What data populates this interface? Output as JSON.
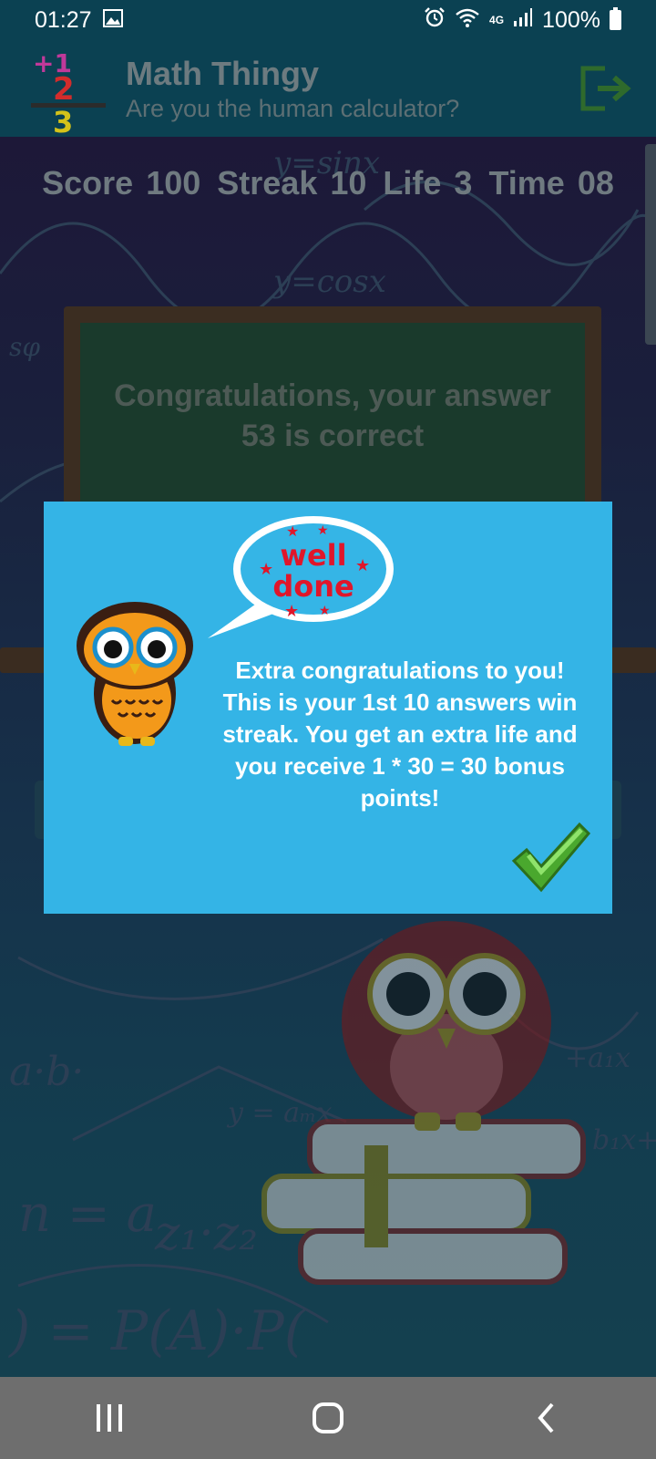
{
  "status_bar": {
    "time": "01:27",
    "network": "4G",
    "battery": "100%",
    "icons": [
      "image-icon",
      "alarm-icon",
      "wifi-icon",
      "signal-icon",
      "battery-icon"
    ]
  },
  "app_bar": {
    "title": "Math Thingy",
    "subtitle": "Are you the human calculator?",
    "logo": {
      "top": "+1",
      "middle": "2",
      "bottom": "3"
    },
    "exit_icon": "exit-icon"
  },
  "stats": {
    "score_label": "Score",
    "score_value": "100",
    "streak_label": "Streak",
    "streak_value": "10",
    "life_label": "Life",
    "life_value": "3",
    "time_label": "Time",
    "time_value": "08"
  },
  "chalkboard": {
    "line1": "Congratulations, your answer",
    "line2": "53 is correct"
  },
  "dialog": {
    "bubble_text_1": "well",
    "bubble_text_2": "done",
    "line1": "Extra congratulations to you!",
    "line2": "This is your 1st 10 answers win",
    "line3": "streak. You get an extra life and",
    "line4": "you receive 1 * 30 = 30 bonus",
    "line5": "points!",
    "confirm_icon": "checkmark-icon"
  },
  "colors": {
    "bar": "#0b4152",
    "dialog": "#34b4e6",
    "nav": "#6e6e6e"
  }
}
